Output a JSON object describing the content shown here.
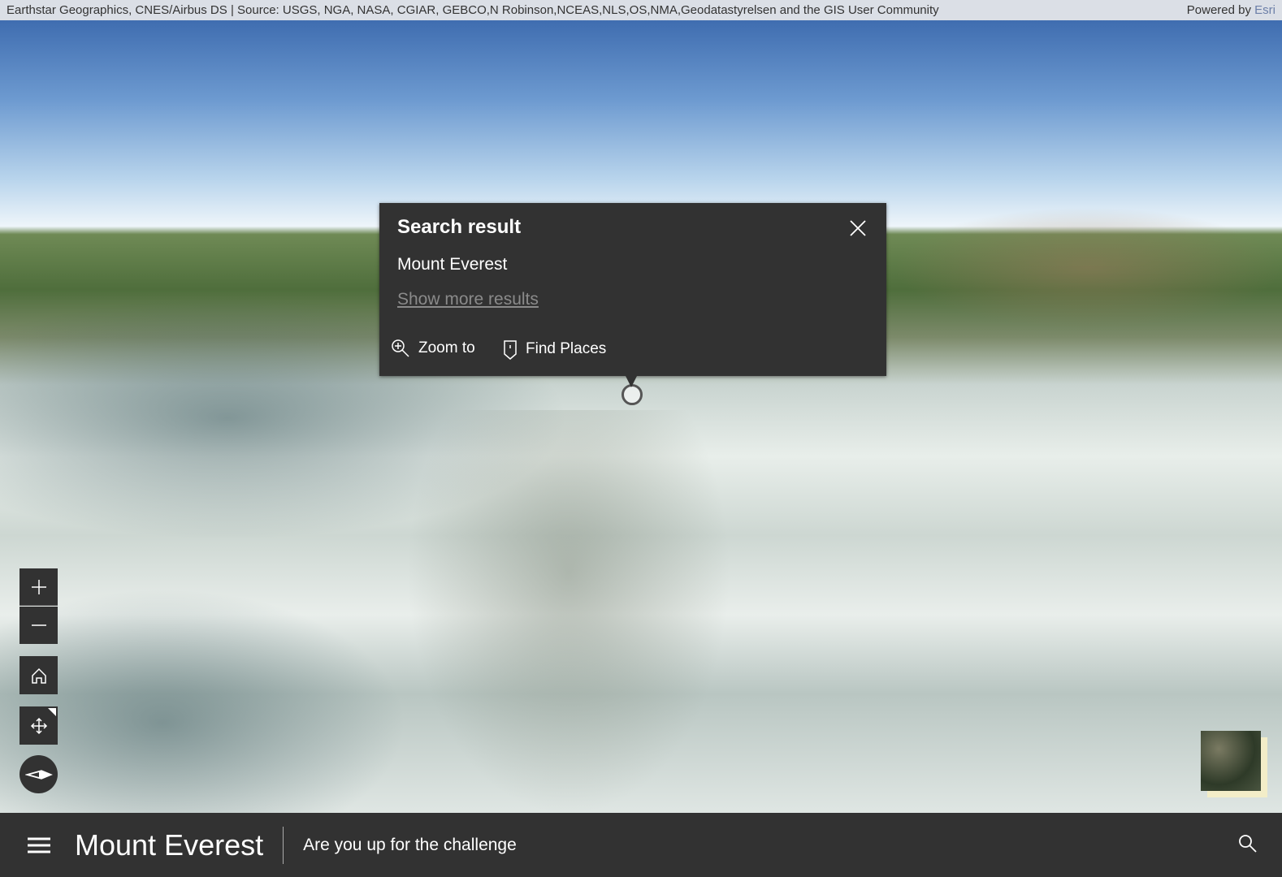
{
  "attribution": {
    "text": "Earthstar Geographics, CNES/Airbus DS | Source: USGS, NGA, NASA, CGIAR, GEBCO,N Robinson,NCEAS,NLS,OS,NMA,Geodatastyrelsen and the GIS User Community",
    "powered_prefix": "Powered by",
    "powered_brand": "Esri"
  },
  "popup": {
    "title": "Search result",
    "result": "Mount Everest",
    "more_link": "Show more results",
    "actions": [
      {
        "label": "Zoom to",
        "icon": "zoom-in-icon"
      },
      {
        "label": "Find Places",
        "icon": "map-pin-icon"
      }
    ]
  },
  "controls": {
    "zoom_in": "plus-icon",
    "zoom_out": "minus-icon",
    "home": "home-icon",
    "pan": "move-icon",
    "compass": "compass-icon"
  },
  "footer": {
    "title": "Mount Everest",
    "subtitle": "Are you up for the challenge"
  }
}
